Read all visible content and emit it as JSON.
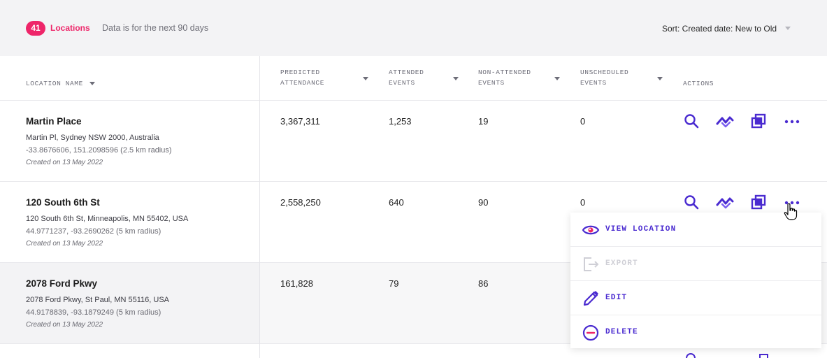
{
  "header": {
    "count": "41",
    "count_label": "Locations",
    "note": "Data is for the next 90 days",
    "sort_label": "Sort: Created date: New to Old"
  },
  "columns": {
    "location_name": "LOCATION NAME",
    "predicted_line1": "PREDICTED",
    "predicted_line2": "ATTENDANCE",
    "attended_line1": "ATTENDED",
    "attended_line2": "EVENTS",
    "non_attended_line1": "NON-ATTENDED",
    "non_attended_line2": "EVENTS",
    "unscheduled_line1": "UNSCHEDULED",
    "unscheduled_line2": "EVENTS",
    "actions": "ACTIONS"
  },
  "rows": [
    {
      "name": "Martin Place",
      "address": "Martin Pl, Sydney NSW 2000, Australia",
      "coords": "-33.8676606, 151.2098596 (2.5 km radius)",
      "created": "Created on 13 May 2022",
      "predicted": "3,367,311",
      "attended": "1,253",
      "non_attended": "19",
      "unscheduled": "0"
    },
    {
      "name": "120 South 6th St",
      "address": "120 South 6th St, Minneapolis, MN 55402, USA",
      "coords": "44.9771237, -93.2690262 (5 km radius)",
      "created": "Created on 13 May 2022",
      "predicted": "2,558,250",
      "attended": "640",
      "non_attended": "90",
      "unscheduled": "0"
    },
    {
      "name": "2078 Ford Pkwy",
      "address": "2078 Ford Pkwy, St Paul, MN 55116, USA",
      "coords": "44.9178839, -93.1879249 (5 km radius)",
      "created": "Created on 13 May 2022",
      "predicted": "161,828",
      "attended": "79",
      "non_attended": "86",
      "unscheduled": ""
    }
  ],
  "menu": {
    "view": "VIEW LOCATION",
    "export": "EXPORT",
    "edit": "EDIT",
    "delete": "DELETE"
  },
  "colors": {
    "accent": "#4a2bd0",
    "pink": "#ee2569",
    "disabled": "#cfcfd6"
  },
  "icons": [
    "search-icon",
    "trend-icon",
    "overlap-icon",
    "more-icon",
    "eye-icon",
    "export-icon",
    "pencil-icon",
    "minus-circle-icon",
    "hand-cursor-icon"
  ]
}
